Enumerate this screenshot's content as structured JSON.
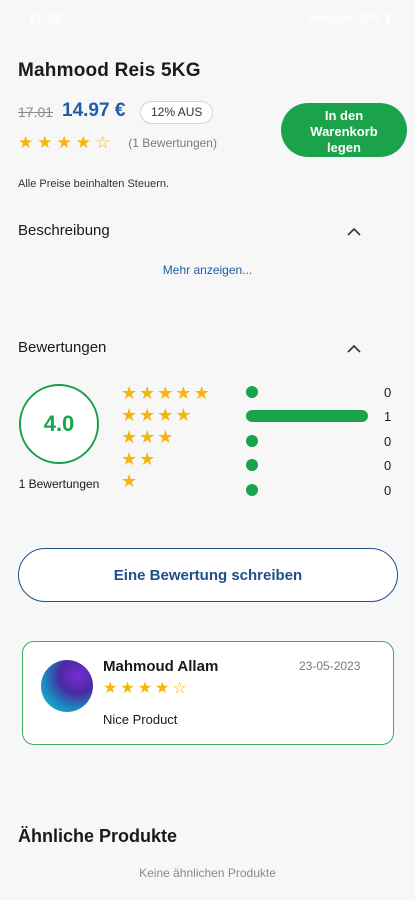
{
  "status_bar": {
    "time": "17:06",
    "right": "55 Manager 98% ▮"
  },
  "product": {
    "title": "Mahmood Reis 5KG",
    "old_price": "17.01",
    "new_price": "14.97 €",
    "discount": "12% AUS",
    "rating_stars": 4,
    "review_count_label": "(1 Bewertungen)",
    "cart_button": "In den Warenkorb legen",
    "tax_note": "Alle Preise beinhalten Steuern."
  },
  "description": {
    "header": "Beschreibung",
    "show_more": "Mehr anzeigen..."
  },
  "reviews": {
    "header": "Bewertungen",
    "average": "4.0",
    "total_label": "1 Bewertungen",
    "distribution": [
      {
        "stars": 5,
        "count": 0,
        "fraction": 0
      },
      {
        "stars": 4,
        "count": 1,
        "fraction": 1
      },
      {
        "stars": 3,
        "count": 0,
        "fraction": 0
      },
      {
        "stars": 2,
        "count": 0,
        "fraction": 0
      },
      {
        "stars": 1,
        "count": 0,
        "fraction": 0
      }
    ],
    "write_button": "Eine Bewertung schreiben",
    "items": [
      {
        "name": "Mahmoud Allam",
        "date": "23-05-2023",
        "stars": 4,
        "text": "Nice Product"
      }
    ]
  },
  "similar": {
    "header": "Ähnliche Produkte",
    "empty": "Keine ähnlichen Produkte"
  },
  "colors": {
    "accent_green": "#1aa34a",
    "price_blue": "#1f5fa8",
    "star_yellow": "#f5b50a"
  },
  "icons": [
    "chevron-up-icon",
    "star-icon",
    "star-outline-icon",
    "avatar"
  ]
}
